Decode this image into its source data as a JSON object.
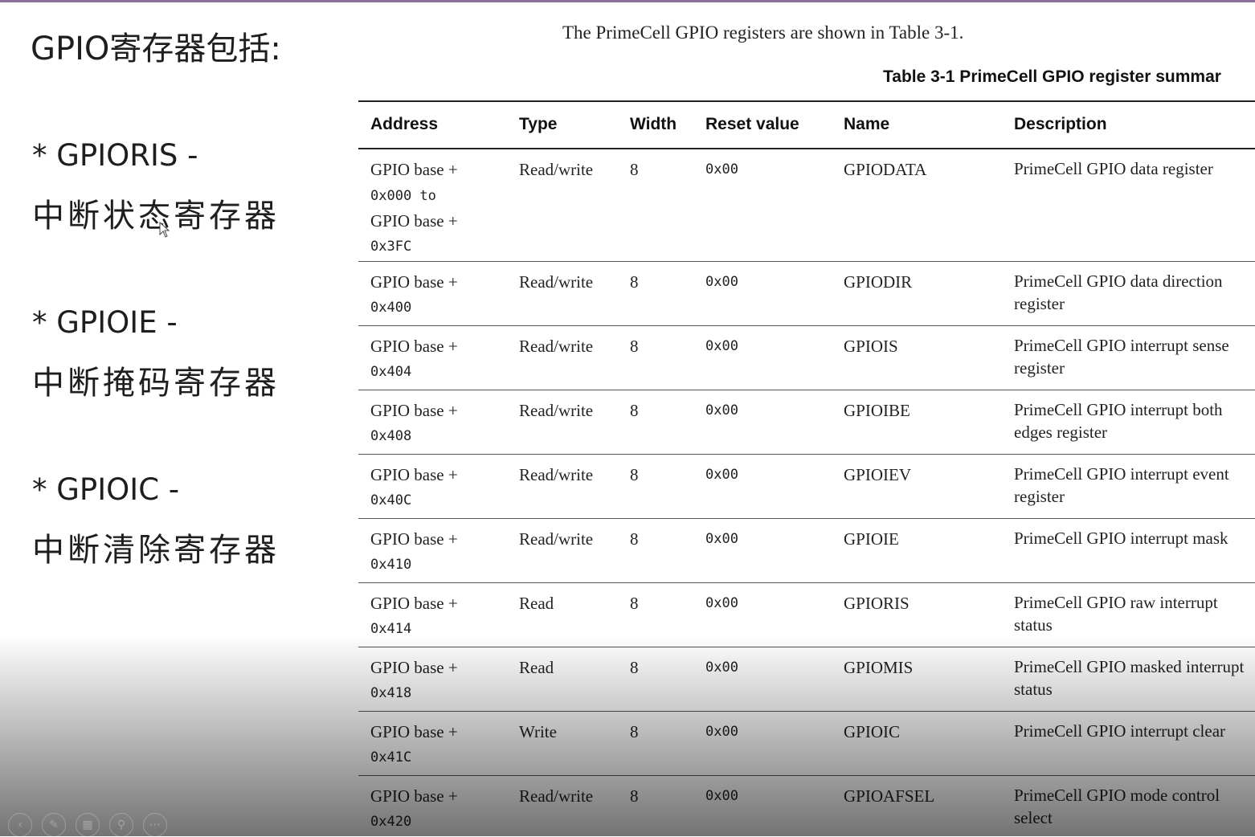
{
  "slide": {
    "title": "GPIO寄存器包括:",
    "bullets": [
      {
        "head": "* GPIORIS -",
        "sub": "中断状态寄存器"
      },
      {
        "head": "* GPIOIE -",
        "sub": "中断掩码寄存器"
      },
      {
        "head": "* GPIOIC -",
        "sub": "中断清除寄存器"
      }
    ]
  },
  "doc": {
    "intro": "The PrimeCell GPIO registers are shown in Table 3-1.",
    "caption": "Table 3-1  PrimeCell GPIO register summar",
    "headers": [
      "Address",
      "Type",
      "Width",
      "Reset value",
      "Name",
      "Description"
    ],
    "rows": [
      {
        "addr1": "GPIO base +",
        "addr2": "0x000 to",
        "addr3": "GPIO base +",
        "addr4": "0x3FC",
        "type": "Read/write",
        "width": "8",
        "reset": "0x00",
        "name": "GPIODATA",
        "desc": "PrimeCell GPIO data register"
      },
      {
        "addr1": "GPIO base +",
        "addr2": "0x400",
        "type": "Read/write",
        "width": "8",
        "reset": "0x00",
        "name": "GPIODIR",
        "desc": "PrimeCell GPIO data direction register"
      },
      {
        "addr1": "GPIO base +",
        "addr2": "0x404",
        "type": "Read/write",
        "width": "8",
        "reset": "0x00",
        "name": "GPIOIS",
        "desc": "PrimeCell GPIO interrupt sense register"
      },
      {
        "addr1": "GPIO base +",
        "addr2": "0x408",
        "type": "Read/write",
        "width": "8",
        "reset": "0x00",
        "name": "GPIOIBE",
        "desc": "PrimeCell GPIO interrupt both edges register"
      },
      {
        "addr1": "GPIO base +",
        "addr2": "0x40C",
        "type": "Read/write",
        "width": "8",
        "reset": "0x00",
        "name": "GPIOIEV",
        "desc": "PrimeCell GPIO interrupt event register"
      },
      {
        "addr1": "GPIO base +",
        "addr2": "0x410",
        "type": "Read/write",
        "width": "8",
        "reset": "0x00",
        "name": "GPIOIE",
        "desc": "PrimeCell GPIO interrupt mask"
      },
      {
        "addr1": "GPIO base +",
        "addr2": "0x414",
        "type": "Read",
        "width": "8",
        "reset": "0x00",
        "name": "GPIORIS",
        "desc": "PrimeCell GPIO raw interrupt status"
      },
      {
        "addr1": "GPIO base +",
        "addr2": "0x418",
        "type": "Read",
        "width": "8",
        "reset": "0x00",
        "name": "GPIOMIS",
        "desc": "PrimeCell GPIO masked interrupt status"
      },
      {
        "addr1": "GPIO base +",
        "addr2": "0x41C",
        "type": "Write",
        "width": "8",
        "reset": "0x00",
        "name": "GPIOIC",
        "desc": "PrimeCell GPIO interrupt clear"
      },
      {
        "addr1": "GPIO base +",
        "addr2": "0x420",
        "type": "Read/write",
        "width": "8",
        "reset": "0x00",
        "name": "GPIOAFSEL",
        "desc": "PrimeCell GPIO mode control select"
      }
    ]
  },
  "controls": [
    "prev-icon",
    "pen-icon",
    "slides-icon",
    "zoom-icon",
    "more-icon"
  ]
}
